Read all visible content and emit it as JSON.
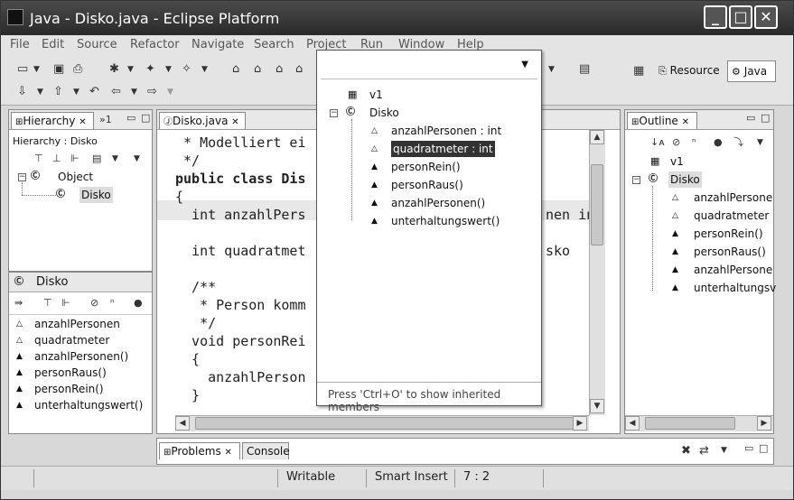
{
  "window": {
    "title": "Java - Disko.java - Eclipse Platform"
  },
  "menu": [
    "File",
    "Edit",
    "Source",
    "Refactor",
    "Navigate",
    "Search",
    "Project",
    "Run",
    "Window",
    "Help"
  ],
  "perspectives": {
    "resource": "Resource",
    "java": "Java"
  },
  "hierarchy": {
    "tab": "Hierarchy",
    "overflow": "»1",
    "label": "Hierarchy : Disko",
    "tree": [
      "Object",
      "Disko"
    ],
    "members_header": "Disko",
    "members": [
      "anzahlPersonen",
      "quadratmeter",
      "anzahlPersonen()",
      "personRaus()",
      "personRein()",
      "unterhaltungswert()"
    ]
  },
  "editor": {
    "tab": "Disko.java",
    "lines": [
      " * Modelliert ei",
      " */",
      "public class Dis",
      "{",
      "  int anzahlPers",
      "",
      "  int quadratmet",
      "",
      "  /**",
      "   * Person komm",
      "   */",
      "  void personRei",
      "  {",
      "    anzahlPerson",
      "  }"
    ],
    "right_fragments": {
      "line5": "nen in",
      "line7": "sko"
    }
  },
  "outline": {
    "tab": "Outline",
    "items": [
      "v1",
      "Disko",
      "anzahlPersone",
      "quadratmeter",
      "personRein()",
      "personRaus()",
      "anzahlPersone",
      "unterhaltungsv"
    ]
  },
  "popup": {
    "items": [
      "v1",
      "Disko",
      "anzahlPersonen : int",
      "quadratmeter : int",
      "personRein()",
      "personRaus()",
      "anzahlPersonen()",
      "unterhaltungswert()"
    ],
    "footer": "Press 'Ctrl+O' to show inherited members"
  },
  "bottom": {
    "problems_tab": "Problems",
    "console_tab": "Console"
  },
  "status": {
    "writable": "Writable",
    "insert": "Smart Insert",
    "position": "7 : 2"
  }
}
